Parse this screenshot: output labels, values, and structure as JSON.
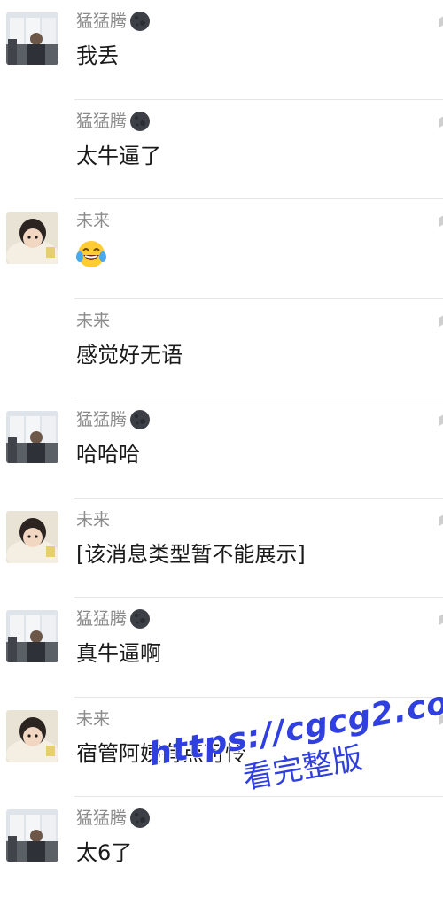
{
  "users": {
    "a": {
      "name": "猛猛腾",
      "emoji_icon": "dark-moon-icon",
      "avatar": "window-photo-avatar"
    },
    "b": {
      "name": "未来",
      "avatar": "child-blanket-avatar"
    }
  },
  "messages": [
    {
      "user": "a",
      "name": "猛猛腾",
      "text": "我丢",
      "show_avatar": true
    },
    {
      "user": "a",
      "name": "猛猛腾",
      "text": "太牛逼了",
      "show_avatar": false
    },
    {
      "user": "b",
      "name": "未来",
      "text": "",
      "emoji": "tears-of-joy-icon",
      "show_avatar": true
    },
    {
      "user": "b",
      "name": "未来",
      "text": "感觉好无语",
      "show_avatar": false
    },
    {
      "user": "a",
      "name": "猛猛腾",
      "text": "哈哈哈",
      "show_avatar": true
    },
    {
      "user": "b",
      "name": "未来",
      "text": "[该消息类型暂不能展示]",
      "show_avatar": true
    },
    {
      "user": "a",
      "name": "猛猛腾",
      "text": "真牛逼啊",
      "show_avatar": true
    },
    {
      "user": "b",
      "name": "未来",
      "text": "宿管阿姨有点可怜",
      "show_avatar": true
    },
    {
      "user": "a",
      "name": "猛猛腾",
      "text": "太6了",
      "show_avatar": true
    }
  ],
  "watermark": {
    "url": "https://cgcg2.co",
    "subtitle": "看完整版"
  },
  "colors": {
    "name": "#8b8b8b",
    "text": "#1a1a1a",
    "divider": "#e6e6e6",
    "watermark": "#2f3fe0"
  }
}
